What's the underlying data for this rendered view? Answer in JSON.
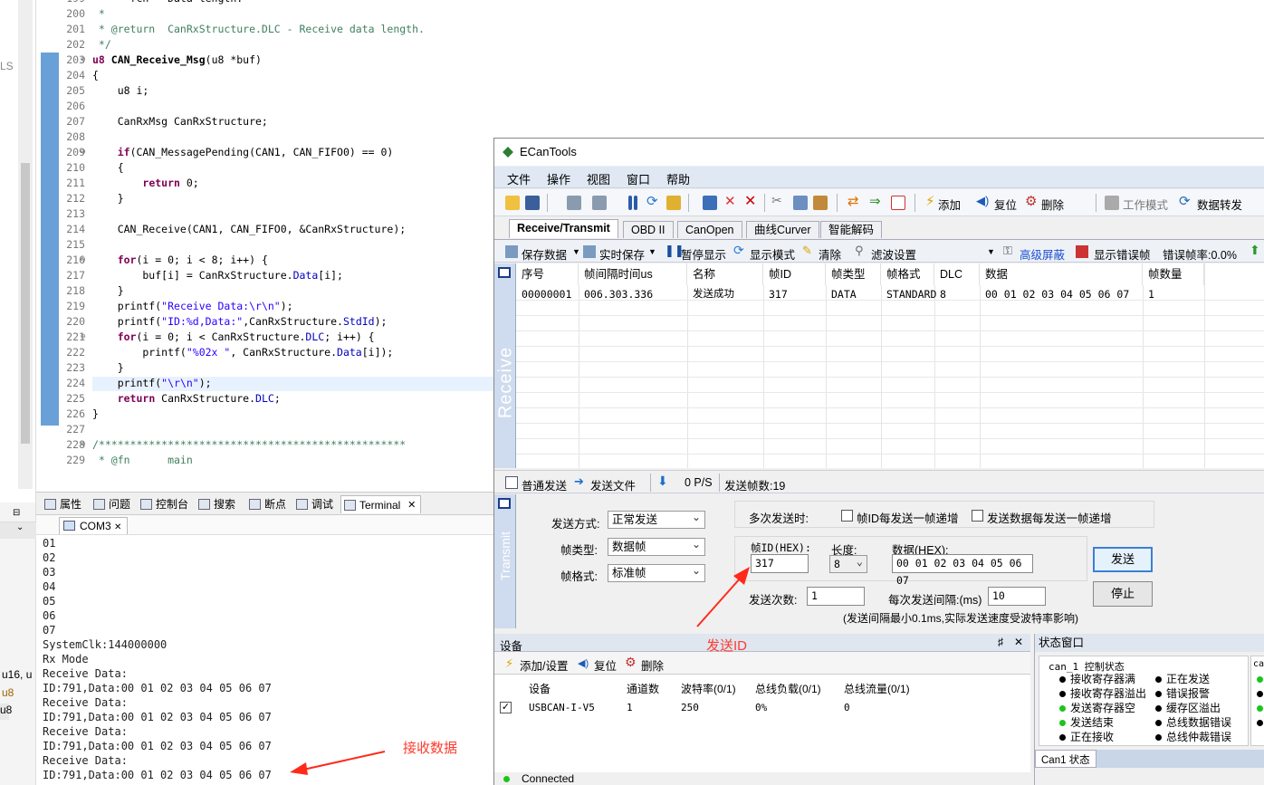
{
  "editor": {
    "lines": [
      {
        "n": "199",
        "code": "      fcn   Data length."
      },
      {
        "n": "200",
        "code": " *"
      },
      {
        "n": "201",
        "code": " * @return  CanRxStructure.DLC - Receive data length."
      },
      {
        "n": "202",
        "code": " */"
      },
      {
        "n": "203",
        "code": "u8 CAN_Receive_Msg(u8 *buf)"
      },
      {
        "n": "204",
        "code": "{"
      },
      {
        "n": "205",
        "code": "    u8 i;"
      },
      {
        "n": "206",
        "code": ""
      },
      {
        "n": "207",
        "code": "    CanRxMsg CanRxStructure;"
      },
      {
        "n": "208",
        "code": ""
      },
      {
        "n": "209",
        "code": "    if(CAN_MessagePending(CAN1, CAN_FIFO0) == 0)"
      },
      {
        "n": "210",
        "code": "    {"
      },
      {
        "n": "211",
        "code": "        return 0;"
      },
      {
        "n": "212",
        "code": "    }"
      },
      {
        "n": "213",
        "code": ""
      },
      {
        "n": "214",
        "code": "    CAN_Receive(CAN1, CAN_FIFO0, &CanRxStructure);"
      },
      {
        "n": "215",
        "code": ""
      },
      {
        "n": "216",
        "code": "    for(i = 0; i < 8; i++) {"
      },
      {
        "n": "217",
        "code": "        buf[i] = CanRxStructure.Data[i];"
      },
      {
        "n": "218",
        "code": "    }"
      },
      {
        "n": "219",
        "code": "    printf(\"Receive Data:\\r\\n\");"
      },
      {
        "n": "220",
        "code": "    printf(\"ID:%d,Data:\",CanRxStructure.StdId);"
      },
      {
        "n": "221",
        "code": "    for(i = 0; i < CanRxStructure.DLC; i++) {"
      },
      {
        "n": "222",
        "code": "        printf(\"%02x \", CanRxStructure.Data[i]);"
      },
      {
        "n": "223",
        "code": "    }"
      },
      {
        "n": "224",
        "code": "    printf(\"\\r\\n\");"
      },
      {
        "n": "225",
        "code": "    return CanRxStructure.DLC;"
      },
      {
        "n": "226",
        "code": "}"
      },
      {
        "n": "227",
        "code": ""
      },
      {
        "n": "228",
        "code": "/*************************************************"
      },
      {
        "n": "229",
        "code": " * @fn      main"
      }
    ]
  },
  "left_fragments": [
    "LS",
    "u16, u",
    "u8",
    "u8"
  ],
  "bottom_tabs": [
    "属性",
    "问题",
    "控制台",
    "搜索",
    "断点",
    "调试",
    "Terminal"
  ],
  "com_tab": "COM3",
  "terminal_text": "01\n02\n03\n04\n05\n06\n07\nSystemClk:144000000\nRx Mode\nReceive Data:\nID:791,Data:00 01 02 03 04 05 06 07\nReceive Data:\nID:791,Data:00 01 02 03 04 05 06 07\nReceive Data:\nID:791,Data:00 01 02 03 04 05 06 07\nReceive Data:\nID:791,Data:00 01 02 03 04 05 06 07",
  "annotations": {
    "recv": "接收数据",
    "sendid": "发送ID"
  },
  "ecan": {
    "title": "ECanTools",
    "menu": [
      "文件",
      "操作",
      "视图",
      "窗口",
      "帮助"
    ],
    "toolbar": {
      "add": "添加",
      "reset": "复位",
      "delete": "删除",
      "workmode": "工作模式",
      "forward": "数据转发"
    },
    "tabs": [
      "Receive/Transmit",
      "OBD II",
      "CanOpen",
      "曲线Curver",
      "智能解码"
    ],
    "subbar": {
      "save": "保存数据",
      "realtime": "实时保存",
      "pause": "暂停显示",
      "mode": "显示模式",
      "clear": "清除",
      "filter": "滤波设置",
      "shield": "高级屏蔽",
      "showerr": "显示错误帧",
      "errrate": "错误帧率:0.0%"
    },
    "receive_label": "Receive",
    "columns": [
      "序号",
      "帧间隔时间us",
      "名称",
      "帧ID",
      "帧类型",
      "帧格式",
      "DLC",
      "数据",
      "帧数量"
    ],
    "rows": [
      [
        "00000001",
        "006.303.336",
        "发送成功",
        "317",
        "DATA",
        "STANDARD",
        "8",
        "00 01 02 03 04 05 06 07",
        "1"
      ]
    ],
    "sendbar": {
      "normal": "普通发送",
      "file": "发送文件",
      "rate": "0 P/S",
      "count": "发送帧数:19"
    },
    "transmit_label": "Transmit",
    "tx": {
      "mode_label": "发送方式:",
      "mode": "正常发送",
      "ftype_label": "帧类型:",
      "ftype": "数据帧",
      "fformat_label": "帧格式:",
      "fformat": "标准帧",
      "multi_label": "多次发送时:",
      "chk1": "帧ID每发送一帧递增",
      "chk2": "发送数据每发送一帧递增",
      "id_label": "帧ID(HEX):",
      "id": "317",
      "len_label": "长度:",
      "len": "8",
      "data_label": "数据(HEX):",
      "data": "00 01 02 03 04 05 06 07",
      "times_label": "发送次数:",
      "times": "1",
      "interval_label": "每次发送间隔:(ms)",
      "interval": "10",
      "note": "(发送间隔最小0.1ms,实际发送速度受波特率影响)",
      "send": "发送",
      "stop": "停止"
    },
    "device": {
      "title": "设备",
      "pin": "♯",
      "close": "✕",
      "add": "添加/设置",
      "reset": "复位",
      "delete": "删除",
      "columns": [
        "设备",
        "通道数",
        "波特率(0/1)",
        "总线负载(0/1)",
        "总线流量(0/1)"
      ],
      "row": [
        "USBCAN-I-V5",
        "1",
        "250",
        "0%",
        "0"
      ],
      "status": "Connected"
    },
    "state": {
      "title": "状态窗口",
      "group": "can_1 控制状态",
      "group2": "can",
      "left": [
        "接收寄存器满",
        "接收寄存器溢出",
        "发送寄存器空",
        "发送结束",
        "正在接收"
      ],
      "right": [
        "正在发送",
        "错误报警",
        "缓存区溢出",
        "总线数据错误",
        "总线仲裁错误"
      ],
      "tab": "Can1 状态"
    }
  }
}
